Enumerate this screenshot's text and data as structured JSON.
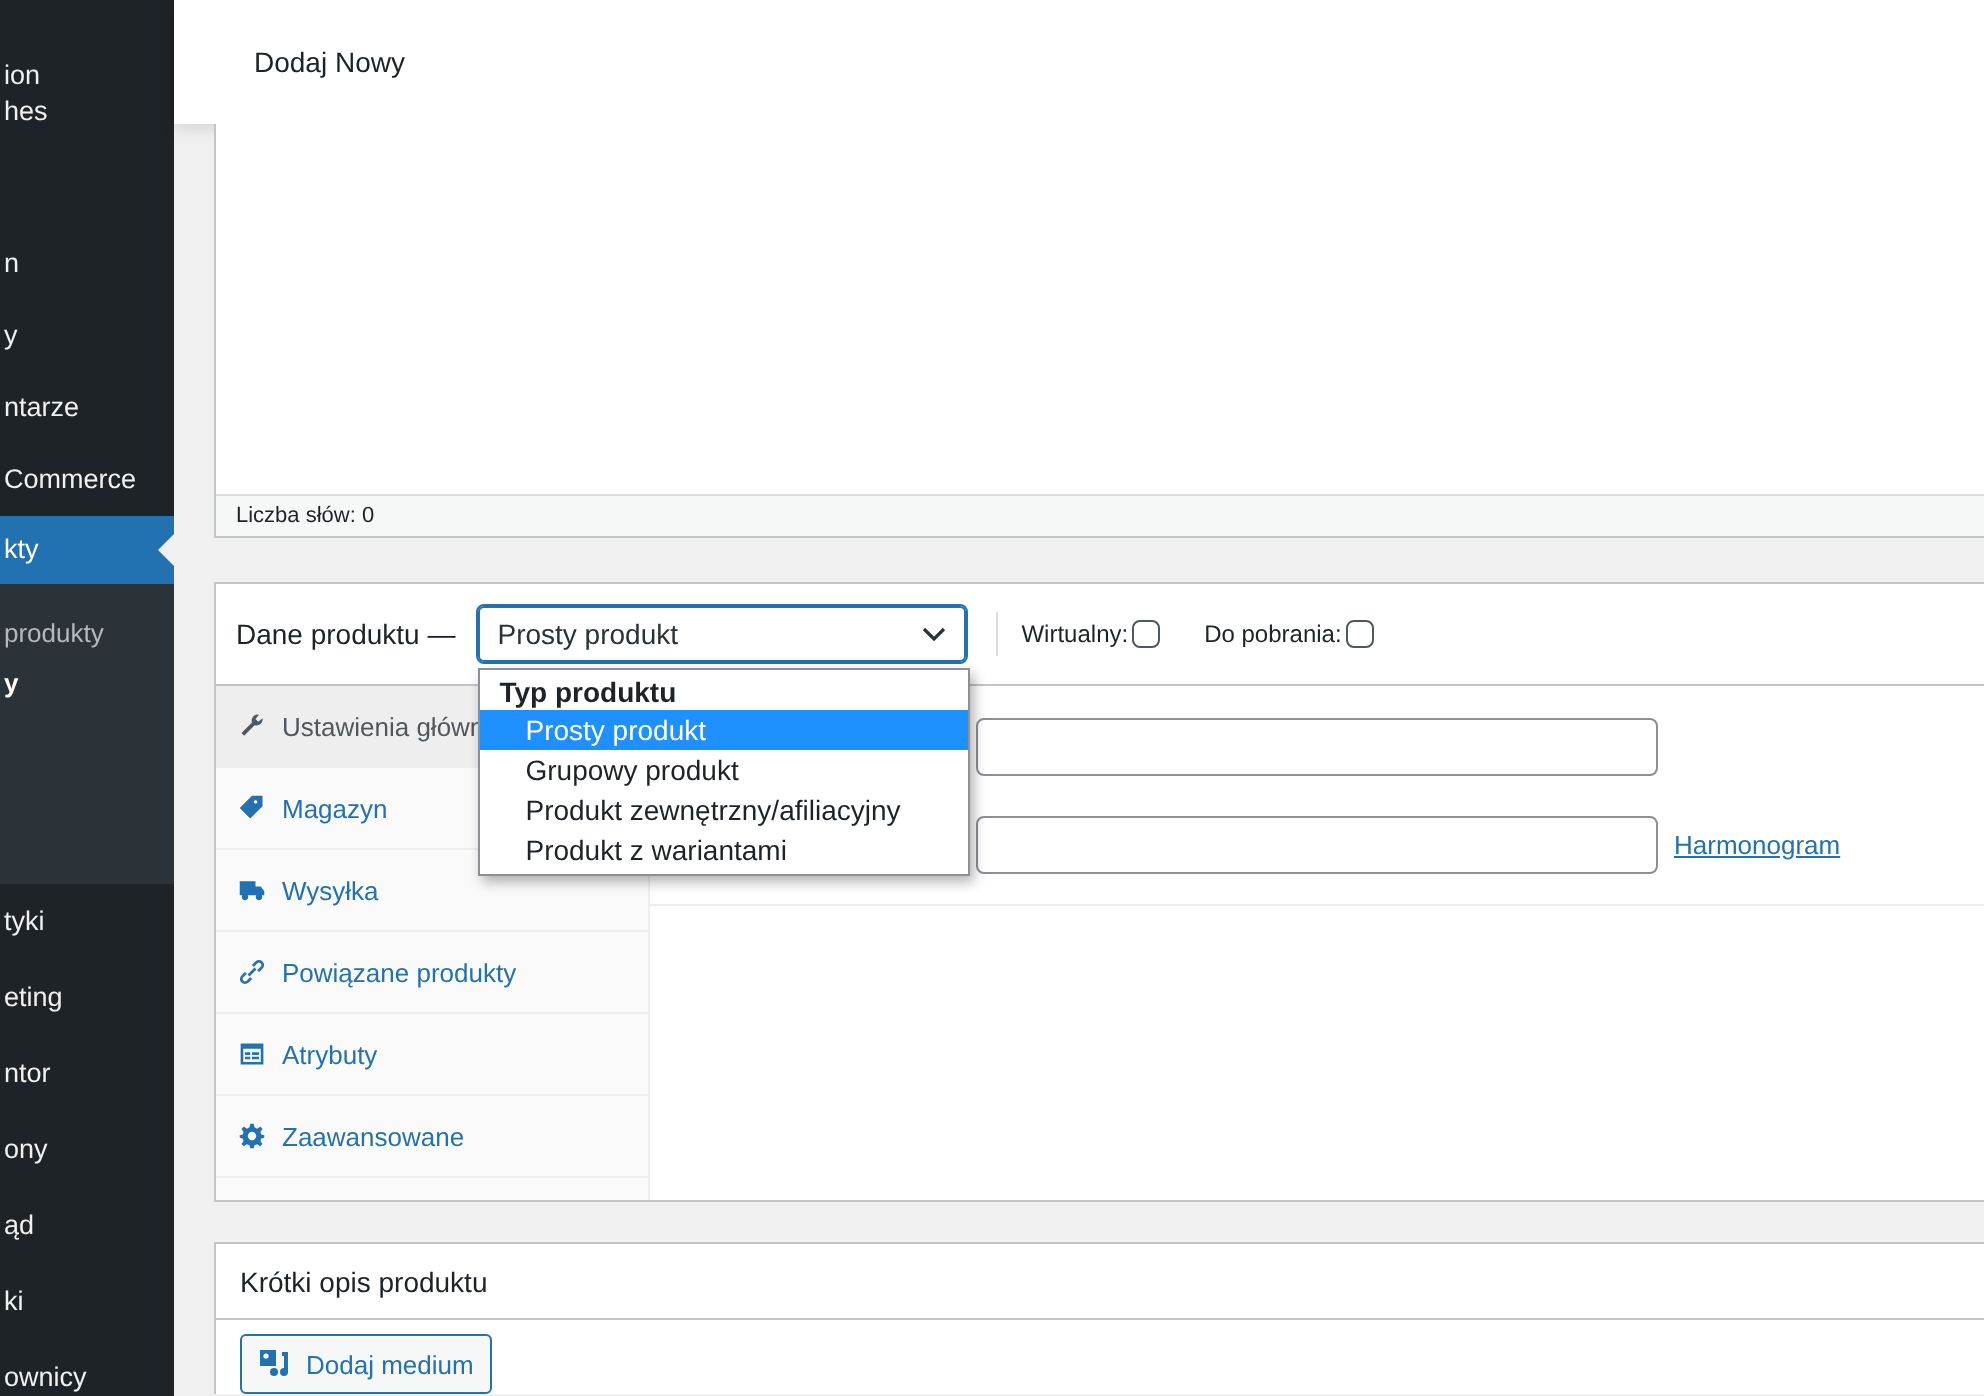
{
  "sidebar": {
    "items": [
      {
        "label": "ion\nhes",
        "kind": "menu",
        "selected": false
      },
      {
        "label": "n",
        "kind": "menu",
        "selected": false
      },
      {
        "label": "y",
        "kind": "menu",
        "selected": false
      },
      {
        "label": "ntarze",
        "kind": "menu",
        "selected": false
      },
      {
        "label": "Commerce",
        "kind": "menu",
        "selected": false
      },
      {
        "label": "kty",
        "kind": "menu",
        "selected": true
      },
      {
        "label": "produkty",
        "kind": "submenu",
        "selected": false
      },
      {
        "label": "y",
        "kind": "submenu",
        "selected": true
      },
      {
        "label": "tyki",
        "kind": "menu",
        "selected": false
      },
      {
        "label": "eting",
        "kind": "menu",
        "selected": false
      },
      {
        "label": "ntor",
        "kind": "menu",
        "selected": false
      },
      {
        "label": "ony",
        "kind": "menu",
        "selected": false
      },
      {
        "label": "ąd",
        "kind": "menu",
        "selected": false
      },
      {
        "label": "ki",
        "kind": "menu",
        "selected": false
      },
      {
        "label": "ownicy",
        "kind": "menu",
        "selected": false
      }
    ]
  },
  "header": {
    "title": "Dodaj Nowy"
  },
  "editor": {
    "word_count": "Liczba słów: 0"
  },
  "product_data": {
    "title": "Dane produktu —",
    "type_select": {
      "value": "Prosty produkt",
      "expanded": true,
      "group_label": "Typ produktu",
      "options": [
        {
          "label": "Prosty produkt",
          "selected": true
        },
        {
          "label": "Grupowy produkt",
          "selected": false
        },
        {
          "label": "Produkt zewnętrzny/afiliacyjny",
          "selected": false
        },
        {
          "label": "Produkt z wariantami",
          "selected": false
        }
      ]
    },
    "checkboxes": [
      {
        "label": "Wirtualny:",
        "checked": false
      },
      {
        "label": "Do pobrania:",
        "checked": false
      }
    ],
    "tabs": [
      {
        "label": "Ustawienia główn",
        "kind": "general",
        "selected": true
      },
      {
        "label": "Magazyn",
        "kind": "inventory",
        "selected": false
      },
      {
        "label": "Wysyłka",
        "kind": "shipping",
        "selected": false
      },
      {
        "label": "Powiązane produkty",
        "kind": "linked",
        "selected": false
      },
      {
        "label": "Atrybuty",
        "kind": "attributes",
        "selected": false
      },
      {
        "label": "Zaawansowane",
        "kind": "advanced",
        "selected": false
      }
    ],
    "schedule_link": "Harmonogram"
  },
  "short_description": {
    "title": "Krótki opis produktu",
    "add_media_button": "Dodaj medium"
  }
}
